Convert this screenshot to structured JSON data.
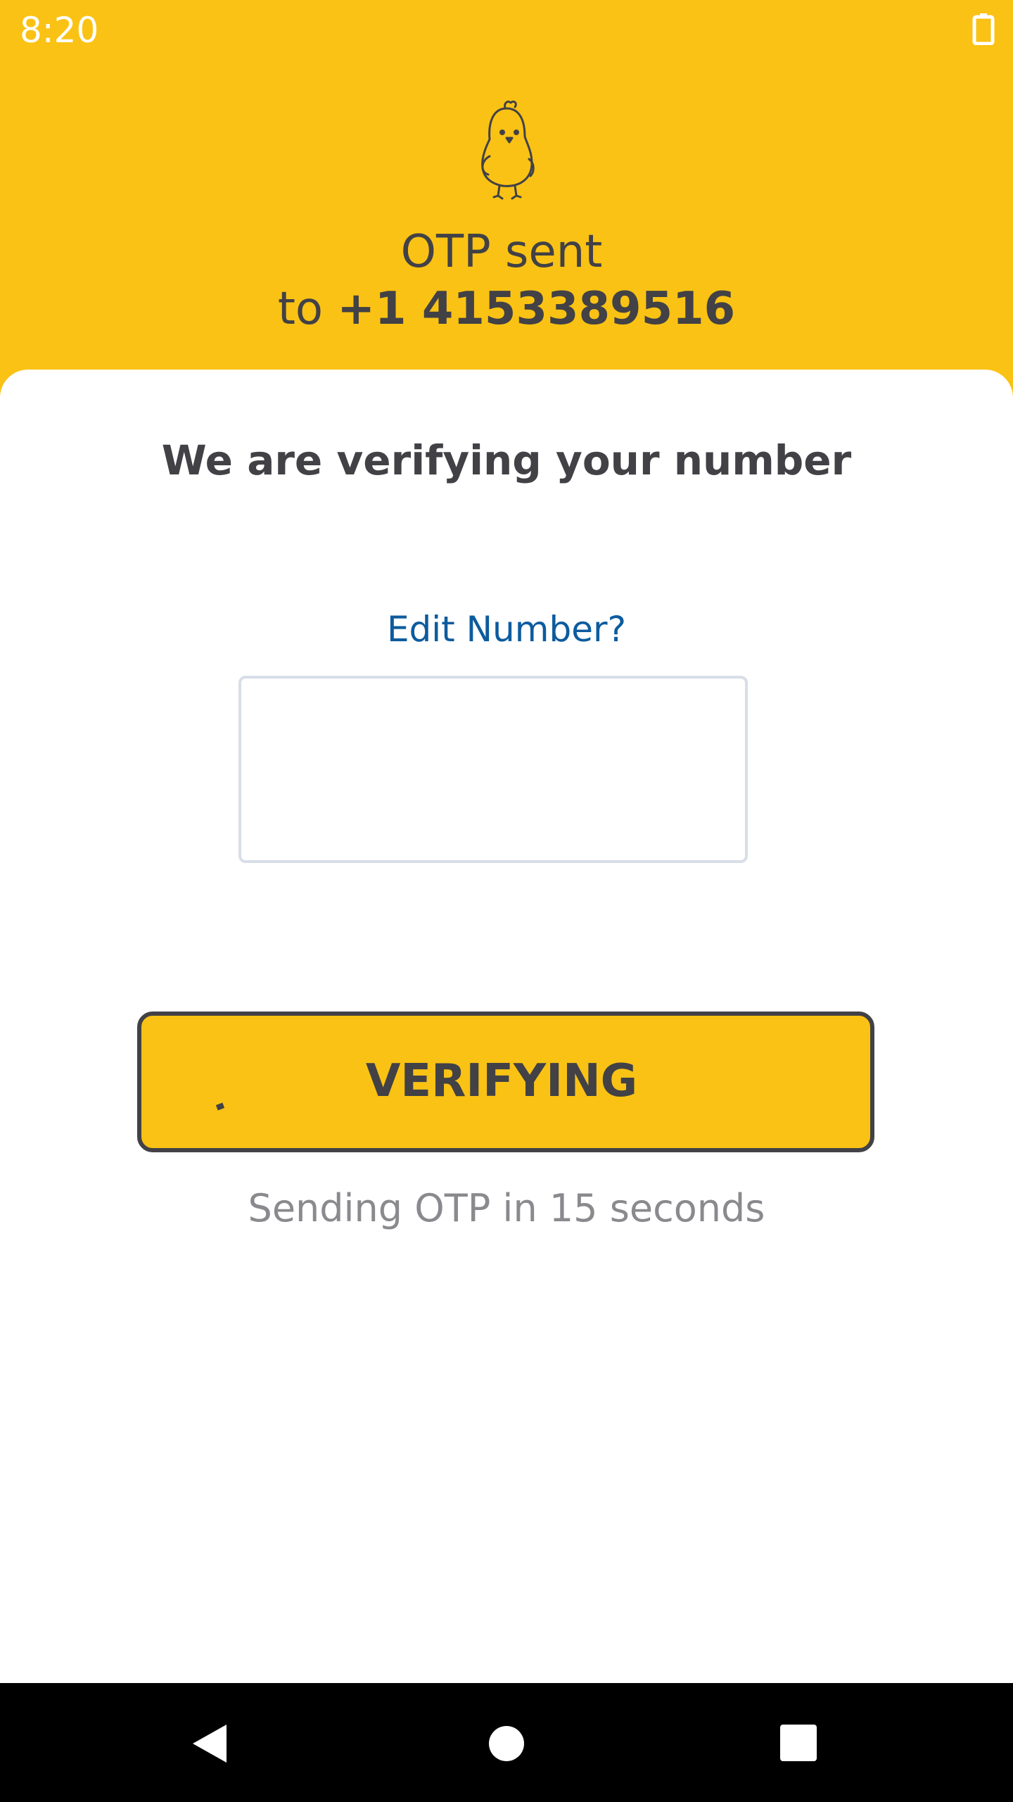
{
  "status_bar": {
    "time": "8:20",
    "battery_icon": "battery-icon"
  },
  "header": {
    "mascot_icon": "chick-mascot-icon",
    "otp_sent_label": "OTP sent",
    "to_label": "to",
    "phone_number": "+1 4153389516"
  },
  "card": {
    "title": "We are verifying your number",
    "edit_number_link": "Edit Number?",
    "otp_input": {
      "value": "",
      "placeholder": ""
    },
    "verify_button_label": "VERIFYING",
    "resend_text": "Sending OTP in 15 seconds"
  },
  "nav_bar": {
    "back_icon": "back-triangle-icon",
    "home_icon": "home-circle-icon",
    "recents_icon": "recents-square-icon"
  },
  "colors": {
    "brand_yellow": "#FAC214",
    "text_dark": "#414146",
    "link_blue": "#0D5B9E",
    "muted_gray": "#8A8A8E",
    "input_border": "#D8DEE8"
  }
}
